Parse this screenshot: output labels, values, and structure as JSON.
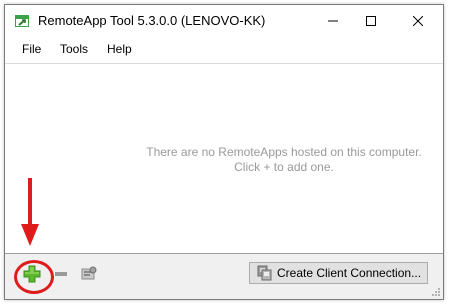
{
  "window": {
    "title": "RemoteApp Tool 5.3.0.0 (LENOVO-KK)"
  },
  "menu": {
    "items": [
      {
        "label": "File"
      },
      {
        "label": "Tools"
      },
      {
        "label": "Help"
      }
    ]
  },
  "content": {
    "empty_line1": "There are no RemoteApps hosted on this computer.",
    "empty_line2": "Click + to add one."
  },
  "toolbar": {
    "create_client_label": "Create Client Connection..."
  },
  "icons": {
    "app": "remoteapp-icon",
    "add": "add-icon",
    "remove": "remove-icon",
    "properties": "properties-icon",
    "create_client": "computer-icon"
  },
  "colors": {
    "annotation": "#e01b1b",
    "add_green": "#5cb82c",
    "empty_text": "#9a9a9a"
  }
}
